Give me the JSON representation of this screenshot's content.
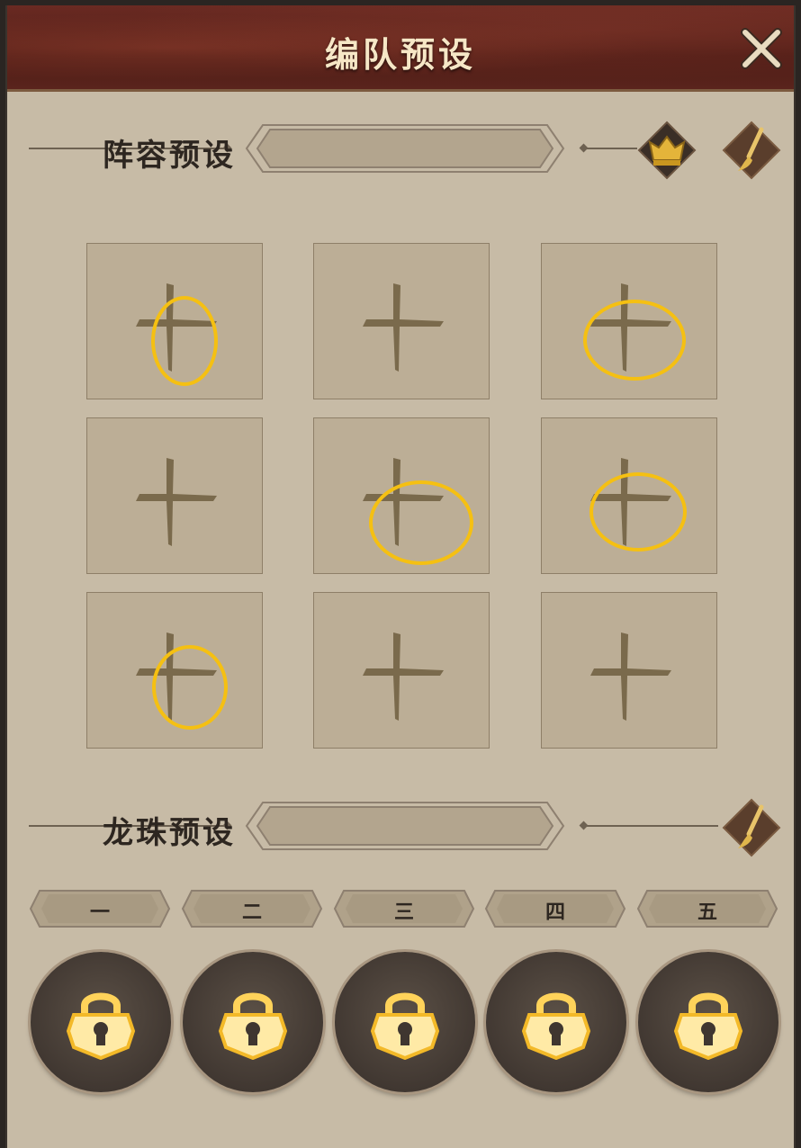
{
  "window": {
    "title": "编队预设",
    "close_icon": "close-x-icon"
  },
  "lineup_section": {
    "title": "阵容预设",
    "buttons": [
      {
        "icon": "gold-crown-icon"
      },
      {
        "icon": "brush-icon"
      }
    ],
    "slots": [
      {
        "icon": "plus-icon",
        "highlighted": true
      },
      {
        "icon": "plus-icon",
        "highlighted": false
      },
      {
        "icon": "plus-icon",
        "highlighted": true
      },
      {
        "icon": "plus-icon",
        "highlighted": false
      },
      {
        "icon": "plus-icon",
        "highlighted": true
      },
      {
        "icon": "plus-icon",
        "highlighted": true
      },
      {
        "icon": "plus-icon",
        "highlighted": true
      },
      {
        "icon": "plus-icon",
        "highlighted": false
      },
      {
        "icon": "plus-icon",
        "highlighted": false
      }
    ]
  },
  "pearl_section": {
    "title": "龙珠预设",
    "buttons": [
      {
        "icon": "brush-icon"
      }
    ],
    "tabs": [
      {
        "label": "一"
      },
      {
        "label": "二"
      },
      {
        "label": "三"
      },
      {
        "label": "四"
      },
      {
        "label": "五"
      }
    ],
    "slots": [
      {
        "icon": "lock-icon"
      },
      {
        "icon": "lock-icon"
      },
      {
        "icon": "lock-icon"
      },
      {
        "icon": "lock-icon"
      },
      {
        "icon": "lock-icon"
      }
    ]
  },
  "colors": {
    "panel_bg": "#c7bba6",
    "title_bar": "#5a221a",
    "title_text": "#f6e7c6",
    "highlight": "#f5c012",
    "lock_glow": "#ffd35a"
  }
}
